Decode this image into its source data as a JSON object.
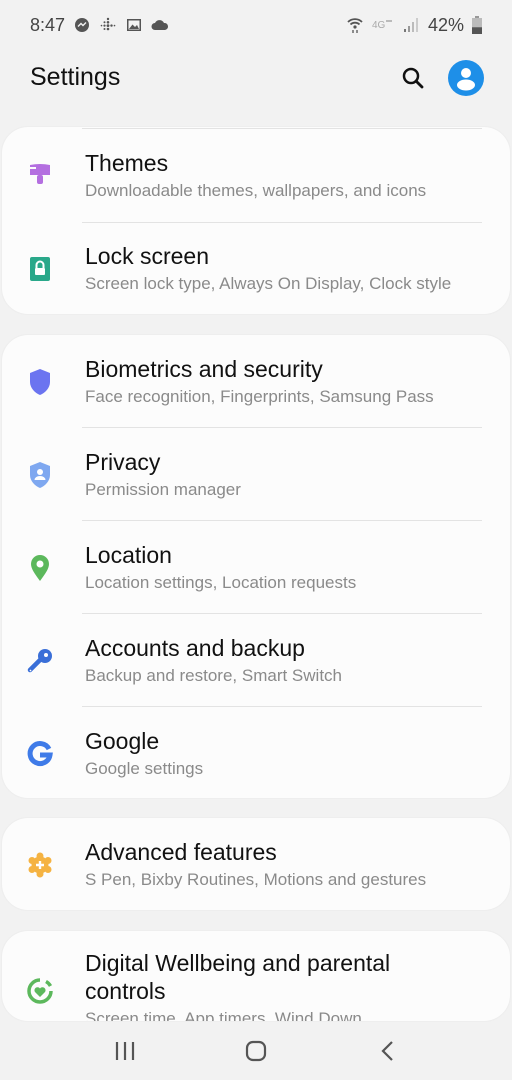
{
  "status_bar": {
    "time": "8:47",
    "left_icons": [
      "messenger-icon",
      "fitbit-icon",
      "gallery-icon",
      "cloud-icon"
    ],
    "right_icons": [
      "wifi-icon",
      "4g-icon",
      "signal-icon"
    ],
    "battery_percent": "42%",
    "battery_level": 0.42
  },
  "header": {
    "title": "Settings",
    "search_icon": "search-icon",
    "avatar_icon": "account-icon",
    "accent_color": "#1e8fe8"
  },
  "groups": [
    {
      "items": [
        {
          "title": "Themes",
          "subtitle": "Downloadable themes, wallpapers, and icons",
          "icon": "paint-brush-icon",
          "color": "#b46fe0"
        },
        {
          "title": "Lock screen",
          "subtitle": "Screen lock type, Always On Display, Clock style",
          "icon": "lock-icon",
          "color": "#2aa88a"
        }
      ]
    },
    {
      "items": [
        {
          "title": "Biometrics and security",
          "subtitle": "Face recognition, Fingerprints, Samsung Pass",
          "icon": "shield-icon",
          "color": "#6b74f0"
        },
        {
          "title": "Privacy",
          "subtitle": "Permission manager",
          "icon": "privacy-shield-icon",
          "color": "#7fa8f0"
        },
        {
          "title": "Location",
          "subtitle": "Location settings, Location requests",
          "icon": "location-pin-icon",
          "color": "#5cb85c"
        },
        {
          "title": "Accounts and backup",
          "subtitle": "Backup and restore, Smart Switch",
          "icon": "key-icon",
          "color": "#3a6fd8"
        },
        {
          "title": "Google",
          "subtitle": "Google settings",
          "icon": "google-icon",
          "color": "#3f7be8"
        }
      ]
    },
    {
      "items": [
        {
          "title": "Advanced features",
          "subtitle": "S Pen, Bixby Routines, Motions and gestures",
          "icon": "gear-plus-icon",
          "color": "#f5b342"
        }
      ]
    },
    {
      "items": [
        {
          "title": "Digital Wellbeing and parental controls",
          "subtitle": "Screen time, App timers, Wind Down",
          "icon": "wellbeing-icon",
          "color": "#5cb85c"
        }
      ]
    }
  ],
  "nav_bar": {
    "recents": "recents-icon",
    "home": "home-icon",
    "back": "back-icon"
  }
}
